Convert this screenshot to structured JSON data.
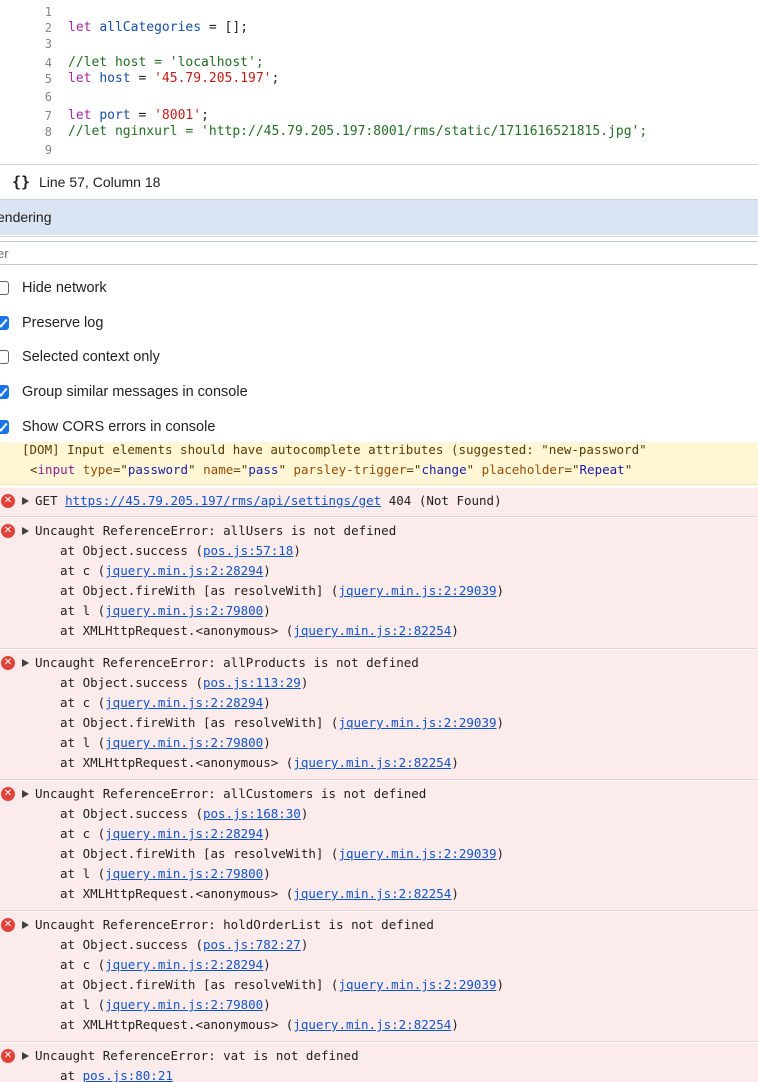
{
  "editor": {
    "lines": [
      {
        "n": "1",
        "parts": []
      },
      {
        "n": "2",
        "parts": [
          {
            "t": "let",
            "c": "kw"
          },
          {
            "t": " "
          },
          {
            "t": "allCategories",
            "c": "var"
          },
          {
            "t": " = [];"
          }
        ]
      },
      {
        "n": "3",
        "parts": []
      },
      {
        "n": "4",
        "parts": [
          {
            "t": "//let host = 'localhost';",
            "c": "com"
          }
        ]
      },
      {
        "n": "5",
        "parts": [
          {
            "t": "let",
            "c": "kw"
          },
          {
            "t": " "
          },
          {
            "t": "host",
            "c": "var"
          },
          {
            "t": " = "
          },
          {
            "t": "'45.79.205.197'",
            "c": "str"
          },
          {
            "t": ";"
          }
        ]
      },
      {
        "n": "6",
        "parts": []
      },
      {
        "n": "7",
        "parts": [
          {
            "t": "let",
            "c": "kw"
          },
          {
            "t": " "
          },
          {
            "t": "port",
            "c": "var"
          },
          {
            "t": " = "
          },
          {
            "t": "'8001'",
            "c": "str"
          },
          {
            "t": ";"
          }
        ]
      },
      {
        "n": "8",
        "parts": [
          {
            "t": "//let nginxurl = 'http://45.79.205.197:8001/rms/static/1711616521815.jpg';",
            "c": "com"
          }
        ]
      },
      {
        "n": "9",
        "parts": []
      }
    ]
  },
  "statusbar": {
    "braces": "{}",
    "position": "Line 57, Column 18"
  },
  "drawer": {
    "tab_label": "endering"
  },
  "filter": {
    "placeholder": "er"
  },
  "settings": [
    {
      "label": "Hide network",
      "checked": false
    },
    {
      "label": "Preserve log",
      "checked": true
    },
    {
      "label": "Selected context only",
      "checked": false
    },
    {
      "label": "Group similar messages in console",
      "checked": true
    },
    {
      "label": "Show CORS errors in console",
      "checked": true
    }
  ],
  "console": {
    "warning": {
      "line1": "[DOM] Input elements should have autocomplete attributes (suggested: \"new-password\"",
      "line2_parts": [
        {
          "t": "<"
        },
        {
          "t": "input",
          "c": "t-tag"
        },
        {
          "t": " "
        },
        {
          "t": "type",
          "c": "t-attr"
        },
        {
          "t": "=\""
        },
        {
          "t": "password",
          "c": "t-val"
        },
        {
          "t": "\" "
        },
        {
          "t": "name",
          "c": "t-attr"
        },
        {
          "t": "=\""
        },
        {
          "t": "pass",
          "c": "t-val"
        },
        {
          "t": "\" "
        },
        {
          "t": "parsley-trigger",
          "c": "t-attr"
        },
        {
          "t": "=\""
        },
        {
          "t": "change",
          "c": "t-val"
        },
        {
          "t": "\" "
        },
        {
          "t": "placeholder",
          "c": "t-attr"
        },
        {
          "t": "=\""
        },
        {
          "t": "Repeat",
          "c": "t-val"
        },
        {
          "t": "\""
        }
      ]
    },
    "get_error": {
      "method": "GET",
      "url": "https://45.79.205.197/rms/api/settings/get",
      "status": "404 (Not Found)"
    },
    "errors": [
      {
        "message": "Uncaught ReferenceError: allUsers is not defined",
        "stack": [
          {
            "pre": "at Object.success (",
            "link": "pos.js:57:18",
            "post": ")"
          },
          {
            "pre": "at c (",
            "link": "jquery.min.js:2:28294",
            "post": ")"
          },
          {
            "pre": "at Object.fireWith [as resolveWith] (",
            "link": "jquery.min.js:2:29039",
            "post": ")"
          },
          {
            "pre": "at l (",
            "link": "jquery.min.js:2:79800",
            "post": ")"
          },
          {
            "pre": "at XMLHttpRequest.<anonymous> (",
            "link": "jquery.min.js:2:82254",
            "post": ")"
          }
        ]
      },
      {
        "message": "Uncaught ReferenceError: allProducts is not defined",
        "stack": [
          {
            "pre": "at Object.success (",
            "link": "pos.js:113:29",
            "post": ")"
          },
          {
            "pre": "at c (",
            "link": "jquery.min.js:2:28294",
            "post": ")"
          },
          {
            "pre": "at Object.fireWith [as resolveWith] (",
            "link": "jquery.min.js:2:29039",
            "post": ")"
          },
          {
            "pre": "at l (",
            "link": "jquery.min.js:2:79800",
            "post": ")"
          },
          {
            "pre": "at XMLHttpRequest.<anonymous> (",
            "link": "jquery.min.js:2:82254",
            "post": ")"
          }
        ]
      },
      {
        "message": "Uncaught ReferenceError: allCustomers is not defined",
        "stack": [
          {
            "pre": "at Object.success (",
            "link": "pos.js:168:30",
            "post": ")"
          },
          {
            "pre": "at c (",
            "link": "jquery.min.js:2:28294",
            "post": ")"
          },
          {
            "pre": "at Object.fireWith [as resolveWith] (",
            "link": "jquery.min.js:2:29039",
            "post": ")"
          },
          {
            "pre": "at l (",
            "link": "jquery.min.js:2:79800",
            "post": ")"
          },
          {
            "pre": "at XMLHttpRequest.<anonymous> (",
            "link": "jquery.min.js:2:82254",
            "post": ")"
          }
        ]
      },
      {
        "message": "Uncaught ReferenceError: holdOrderList is not defined",
        "stack": [
          {
            "pre": "at Object.success (",
            "link": "pos.js:782:27",
            "post": ")"
          },
          {
            "pre": "at c (",
            "link": "jquery.min.js:2:28294",
            "post": ")"
          },
          {
            "pre": "at Object.fireWith [as resolveWith] (",
            "link": "jquery.min.js:2:29039",
            "post": ")"
          },
          {
            "pre": "at l (",
            "link": "jquery.min.js:2:79800",
            "post": ")"
          },
          {
            "pre": "at XMLHttpRequest.<anonymous> (",
            "link": "jquery.min.js:2:82254",
            "post": ")"
          }
        ]
      },
      {
        "message": "Uncaught ReferenceError: vat is not defined",
        "stack": [
          {
            "pre": "at ",
            "link": "pos.js:80:21",
            "post": ""
          }
        ]
      }
    ],
    "colors": {
      "error_bg": "#fcebeb",
      "warning_bg": "#fef6d5",
      "link": "#1155cc",
      "error_icon": "#e0433a",
      "checkbox_accent": "#1a73e8"
    }
  }
}
